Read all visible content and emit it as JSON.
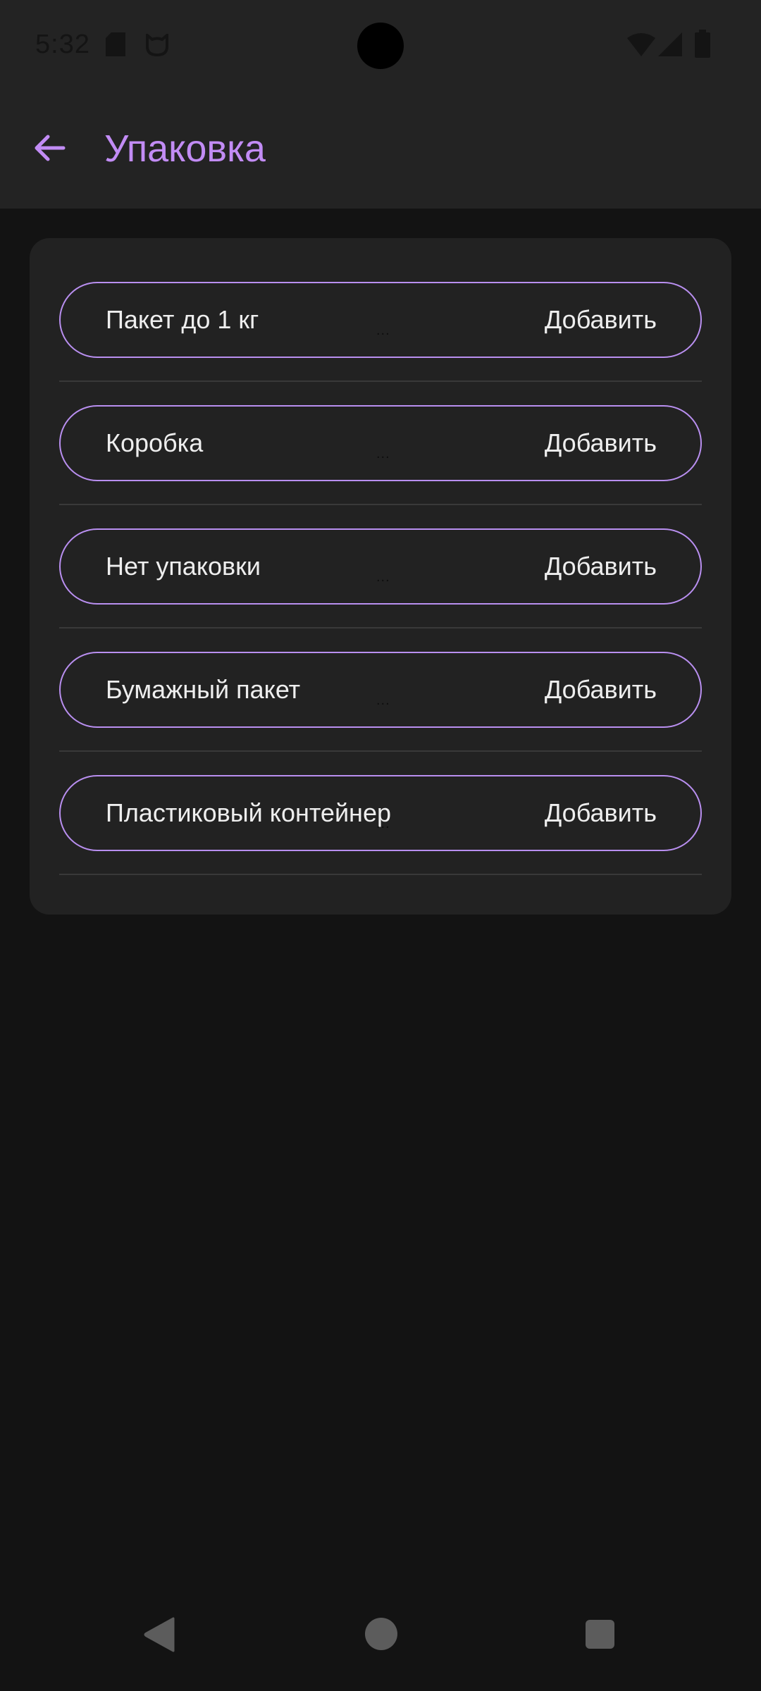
{
  "status_bar": {
    "time": "5:32",
    "icons": [
      "sd-card-icon",
      "cat-icon",
      "wifi-icon",
      "signal-icon",
      "battery-icon"
    ]
  },
  "header": {
    "title": "Упаковка",
    "back_icon": "arrow-left-icon"
  },
  "packaging": {
    "items": [
      {
        "label": "Пакет до 1 кг",
        "action": "Добавить",
        "dots": "..."
      },
      {
        "label": "Коробка",
        "action": "Добавить",
        "dots": "..."
      },
      {
        "label": "Нет упаковки",
        "action": "Добавить",
        "dots": "..."
      },
      {
        "label": "Бумажный пакет",
        "action": "Добавить",
        "dots": "..."
      },
      {
        "label": "Пластиковый контейнер",
        "action": "Добавить",
        "dots": "..."
      }
    ]
  },
  "nav_bar": {
    "icons": [
      "nav-back-icon",
      "nav-home-icon",
      "nav-recents-icon"
    ]
  },
  "colors": {
    "accent": "#c28cf5",
    "outline": "#b98ff0",
    "background": "#131313",
    "surface": "#222222"
  }
}
